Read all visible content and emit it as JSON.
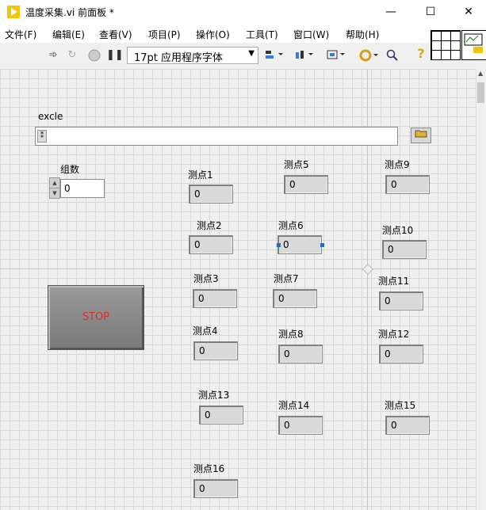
{
  "window": {
    "title": "温度采集.vi 前面板 *",
    "minimize": "—",
    "maximize": "☐",
    "close": "✕"
  },
  "menu": [
    "文件(F)",
    "编辑(E)",
    "查看(V)",
    "项目(P)",
    "操作(O)",
    "工具(T)",
    "窗口(W)",
    "帮助(H)"
  ],
  "toolbar": {
    "font": "17pt 应用程序字体",
    "font_arrow": "▼",
    "help": "?"
  },
  "panel": {
    "path_label": "excle",
    "path_value": "",
    "group_label": "组数",
    "group_value": "0",
    "stop_label": "STOP",
    "points": [
      {
        "label": "测点1",
        "value": "0"
      },
      {
        "label": "测点2",
        "value": "0"
      },
      {
        "label": "测点3",
        "value": "0"
      },
      {
        "label": "测点4",
        "value": "0"
      },
      {
        "label": "测点5",
        "value": "0"
      },
      {
        "label": "测点6",
        "value": "0"
      },
      {
        "label": "测点7",
        "value": "0"
      },
      {
        "label": "测点8",
        "value": "0"
      },
      {
        "label": "测点9",
        "value": "0"
      },
      {
        "label": "测点10",
        "value": "0"
      },
      {
        "label": "测点11",
        "value": "0"
      },
      {
        "label": "测点12",
        "value": "0"
      },
      {
        "label": "测点13",
        "value": "0"
      },
      {
        "label": "测点14",
        "value": "0"
      },
      {
        "label": "测点15",
        "value": "0"
      },
      {
        "label": "测点16",
        "value": "0"
      }
    ]
  }
}
